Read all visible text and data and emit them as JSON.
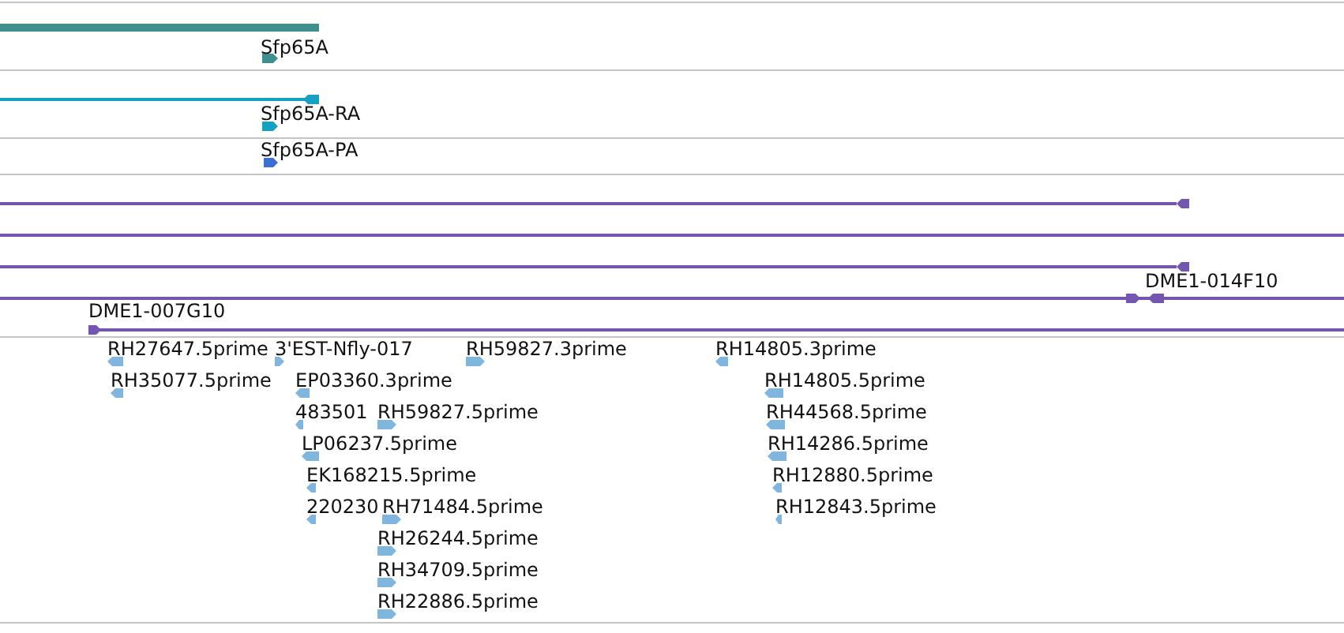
{
  "tracks": [
    {
      "kind": "gene",
      "color": "#3f8f8f",
      "features": [
        {
          "kind": "bar"
        },
        {
          "kind": "arrow",
          "label": "Sfp65A",
          "reverse": false
        }
      ]
    },
    {
      "kind": "transcript",
      "color": "#16a0c2",
      "features": [
        {
          "kind": "line",
          "heads": [
            {
              "reverse": true
            }
          ]
        },
        {
          "kind": "arrow",
          "label": "Sfp65A-RA",
          "reverse": false
        }
      ]
    },
    {
      "kind": "protein",
      "color": "#3b6fd4",
      "features": [
        {
          "kind": "arrow",
          "label": "Sfp65A-PA",
          "reverse": false
        }
      ]
    },
    {
      "kind": "alignment",
      "color": "#7456b0",
      "features": [
        {
          "kind": "line",
          "heads": [
            {
              "reverse": true
            }
          ]
        },
        {
          "kind": "line"
        },
        {
          "kind": "line",
          "heads": [
            {
              "reverse": true
            }
          ]
        },
        {
          "kind": "line",
          "label": "DME1-014F10",
          "heads": [
            {
              "reverse": false
            },
            {
              "reverse": true
            }
          ]
        },
        {
          "kind": "line",
          "label": "DME1-007G10",
          "heads": [
            {
              "reverse": false
            }
          ]
        }
      ]
    },
    {
      "kind": "est",
      "color": "#80b6de",
      "features": [
        {
          "kind": "arrow",
          "label": "RH27647.5prime",
          "reverse": true
        },
        {
          "kind": "arrow",
          "label": "3'EST-Nfly-017",
          "reverse": false
        },
        {
          "kind": "arrow",
          "label": "RH59827.3prime",
          "reverse": false
        },
        {
          "kind": "arrow",
          "label": "RH14805.3prime",
          "reverse": true
        },
        {
          "kind": "arrow",
          "label": "RH35077.5prime",
          "reverse": true
        },
        {
          "kind": "arrow",
          "label": "EP03360.3prime",
          "reverse": true
        },
        {
          "kind": "arrow",
          "label": "RH14805.5prime",
          "reverse": true
        },
        {
          "kind": "arrow",
          "label": "483501",
          "reverse": true
        },
        {
          "kind": "arrow",
          "label": "RH59827.5prime",
          "reverse": false
        },
        {
          "kind": "arrow",
          "label": "RH44568.5prime",
          "reverse": true
        },
        {
          "kind": "arrow",
          "label": "LP06237.5prime",
          "reverse": true
        },
        {
          "kind": "arrow",
          "label": "RH14286.5prime",
          "reverse": true
        },
        {
          "kind": "arrow",
          "label": "EK168215.5prime",
          "reverse": true
        },
        {
          "kind": "arrow",
          "label": "RH12880.5prime",
          "reverse": true
        },
        {
          "kind": "arrow",
          "label": "220230",
          "reverse": true
        },
        {
          "kind": "arrow",
          "label": "RH71484.5prime",
          "reverse": false
        },
        {
          "kind": "arrow",
          "label": "RH12843.5prime",
          "reverse": true
        },
        {
          "kind": "arrow",
          "label": "RH26244.5prime",
          "reverse": false
        },
        {
          "kind": "arrow",
          "label": "RH34709.5prime",
          "reverse": false
        },
        {
          "kind": "arrow",
          "label": "RH22886.5prime",
          "reverse": false
        }
      ]
    }
  ]
}
